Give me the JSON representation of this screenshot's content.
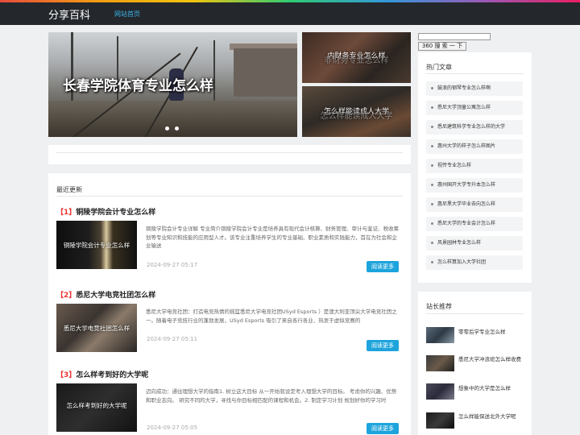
{
  "site": {
    "brand": "分享百科",
    "nav_home": "网站首页"
  },
  "carousel": {
    "caption": "长春学院体育专业怎么样",
    "side_images": [
      {
        "caption": "内财务专业怎么样",
        "ghost": "非财务专业怎么样"
      },
      {
        "caption": "怎么样能读成人大学",
        "ghost": "怎么样能读成人大学"
      }
    ]
  },
  "search": {
    "placeholder": "",
    "button_label": "360 搜 索 一 下"
  },
  "latest": {
    "title": "最近更新",
    "read_more": "阅读更多",
    "posts": [
      {
        "num": "【1】",
        "title": "铜陵学院会计专业怎么样",
        "thumb_caption": "铜陵学院会计专业怎么样",
        "excerpt": "铜陵学院会计专业详解 专业简介铜陵学院会计专业是培养具有现代会计核算、财务管理、审计与鉴证、税收筹划等专业知识和技能的应用型人才。该专业注重培养学生的专业基础、职业素质和实践能力，首在为社会和企业输送",
        "date": "2024-09-27 05:17"
      },
      {
        "num": "【2】",
        "title": "悉尼大学电竞社团怎么样",
        "thumb_caption": "悉尼大学电竞社团怎么样",
        "excerpt": "悉尼大学电竞社团：打造电竞热情的摇篮悉尼大学电竞社团USyd Esports ）是澳大利亚顶尖大学电竞社团之一。随着电子竞技行业的蓬勃发展，USyd Esports 吸引了来自各行各业、热衷于虚拟竞赛的",
        "date": "2024-09-27 05:11"
      },
      {
        "num": "【3】",
        "title": "怎么样考到好的大学呢",
        "thumb_caption": "怎么样考到好的大学呢",
        "excerpt": "迈向成功：通往理想大学的指南1. 树立这大目标 从一开始就设定考入理想大学的目标。 考虑你的兴趣、优势和职业志向。 研究不同的大学，寻找与你目标相匹配的课程和机会。2. 制定学习计划 规划好你的学习时",
        "date": "2024-09-27 05:05"
      }
    ]
  },
  "hot": {
    "title": "热门文章",
    "items": [
      "鼓浪的钢琴专业怎么样啊",
      "悉尼大学顶童公寓怎么样",
      "悉尼建筑科学专业怎么样的大学",
      "惠州大学的样子怎么样图片",
      "视传专业怎么样",
      "惠州国开大学专升本怎么样",
      "惠尼黑大学毕业去向怎么样",
      "悉尼大学的专业会计怎么样",
      "风景园林专业怎么样",
      "怎么样算加入大学社团"
    ]
  },
  "recommend": {
    "title": "站长推荐",
    "items": [
      "零零后学专业怎么样",
      "悉尼大学冲浪班怎么样收费",
      "想象中的大学是怎么样",
      "怎么样能保送北外大学呢"
    ]
  }
}
